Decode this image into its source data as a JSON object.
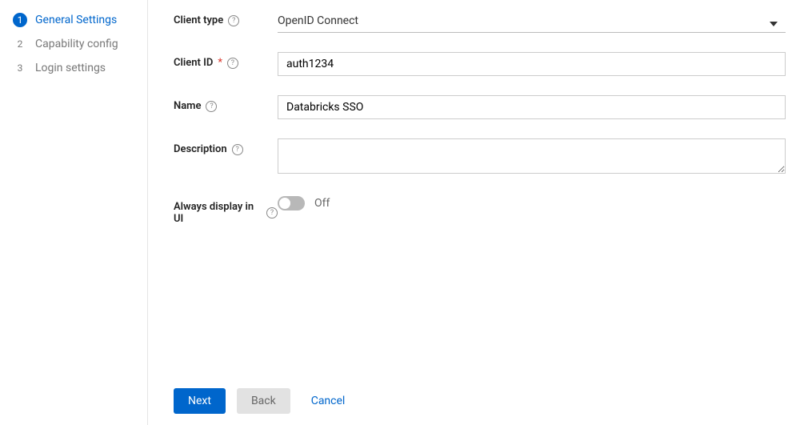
{
  "sidebar": {
    "steps": [
      {
        "num": "1",
        "label": "General Settings",
        "active": true
      },
      {
        "num": "2",
        "label": "Capability config",
        "active": false
      },
      {
        "num": "3",
        "label": "Login settings",
        "active": false
      }
    ]
  },
  "form": {
    "client_type": {
      "label": "Client type",
      "value": "OpenID Connect"
    },
    "client_id": {
      "label": "Client ID",
      "value": "auth1234",
      "required": true
    },
    "name": {
      "label": "Name",
      "value": "Databricks SSO"
    },
    "description": {
      "label": "Description",
      "value": ""
    },
    "always_display": {
      "label": "Always display in UI",
      "state_label": "Off",
      "on": false
    }
  },
  "footer": {
    "next": "Next",
    "back": "Back",
    "cancel": "Cancel"
  }
}
